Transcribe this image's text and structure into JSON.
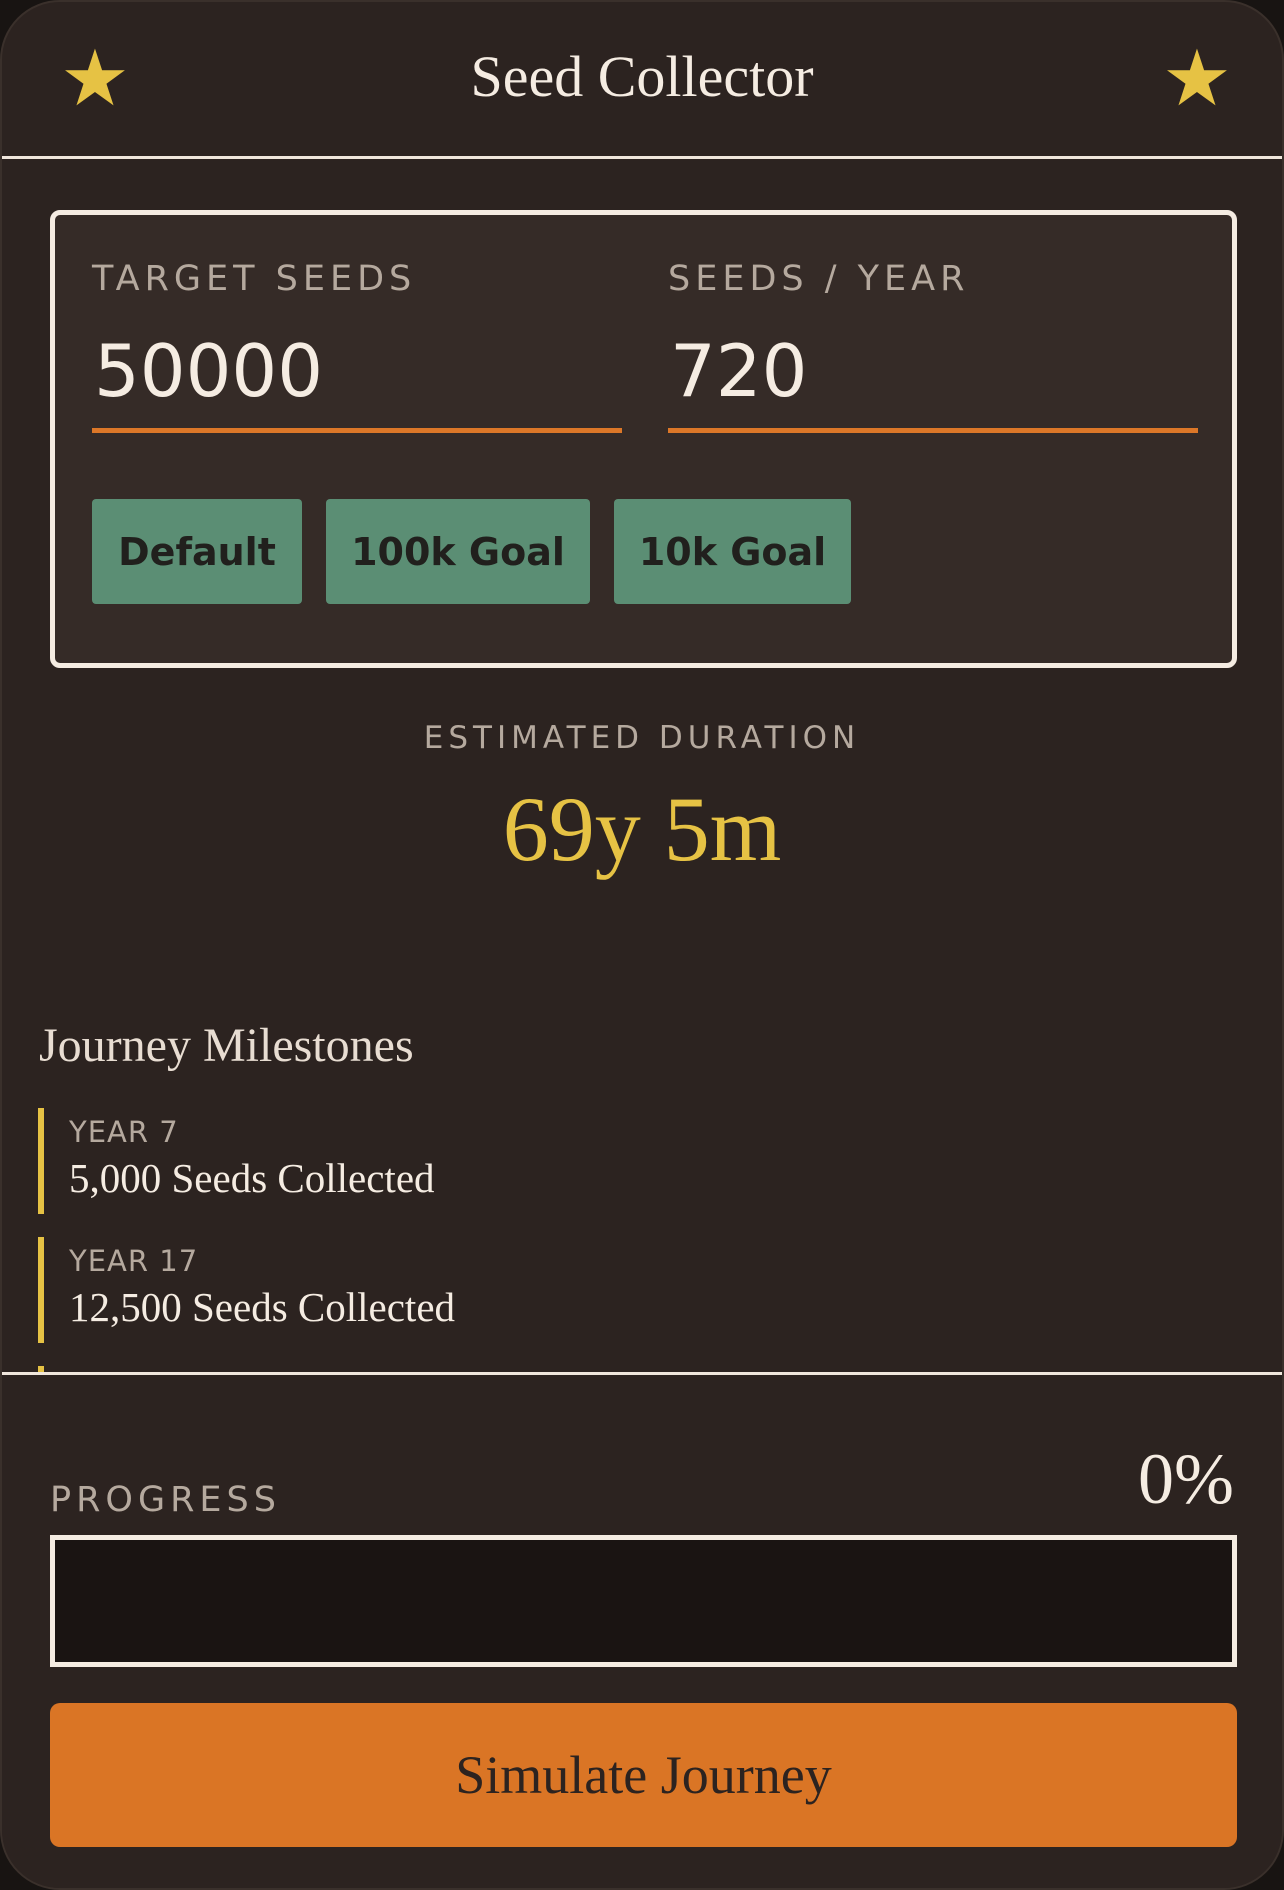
{
  "header": {
    "title": "Seed Collector",
    "left_icon": "star-icon",
    "right_icon": "star-icon",
    "star_glyph": "★"
  },
  "inputs": {
    "target_label": "TARGET SEEDS",
    "target_value": "50000",
    "rate_label": "SEEDS / YEAR",
    "rate_value": "720"
  },
  "presets": [
    "Default",
    "100k Goal",
    "10k Goal"
  ],
  "estimate": {
    "label": "ESTIMATED DURATION",
    "value": "69y 5m"
  },
  "milestones": {
    "title": "Journey Milestones",
    "items": [
      {
        "year": "YEAR 7",
        "text": "5,000 Seeds Collected"
      },
      {
        "year": "YEAR 17",
        "text": "12,500 Seeds Collected"
      },
      {
        "year": "",
        "text": ""
      }
    ]
  },
  "progress": {
    "label": "PROGRESS",
    "percent_text": "0%",
    "fraction": 0
  },
  "action": {
    "simulate_label": "Simulate Journey"
  },
  "colors": {
    "accent_orange": "#dc7728",
    "gold": "#e6c244",
    "preset_green": "#5b8e74",
    "background": "#2c2320"
  }
}
